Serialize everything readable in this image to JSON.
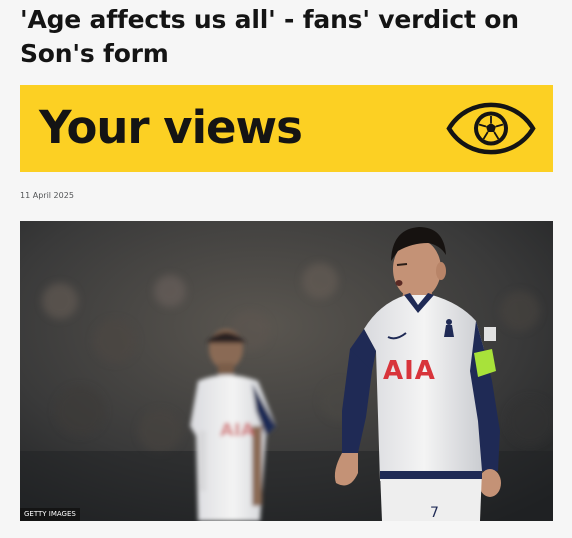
{
  "article": {
    "headline": "'Age affects us all' - fans' verdict on Son's form",
    "date": "11 April 2025"
  },
  "banner": {
    "title": "Your views",
    "icon": "eye-football-icon",
    "background_color": "#fcd023"
  },
  "image": {
    "credit": "GETTY IMAGES",
    "sponsor_text": "AIA",
    "shirt_number": "7"
  }
}
